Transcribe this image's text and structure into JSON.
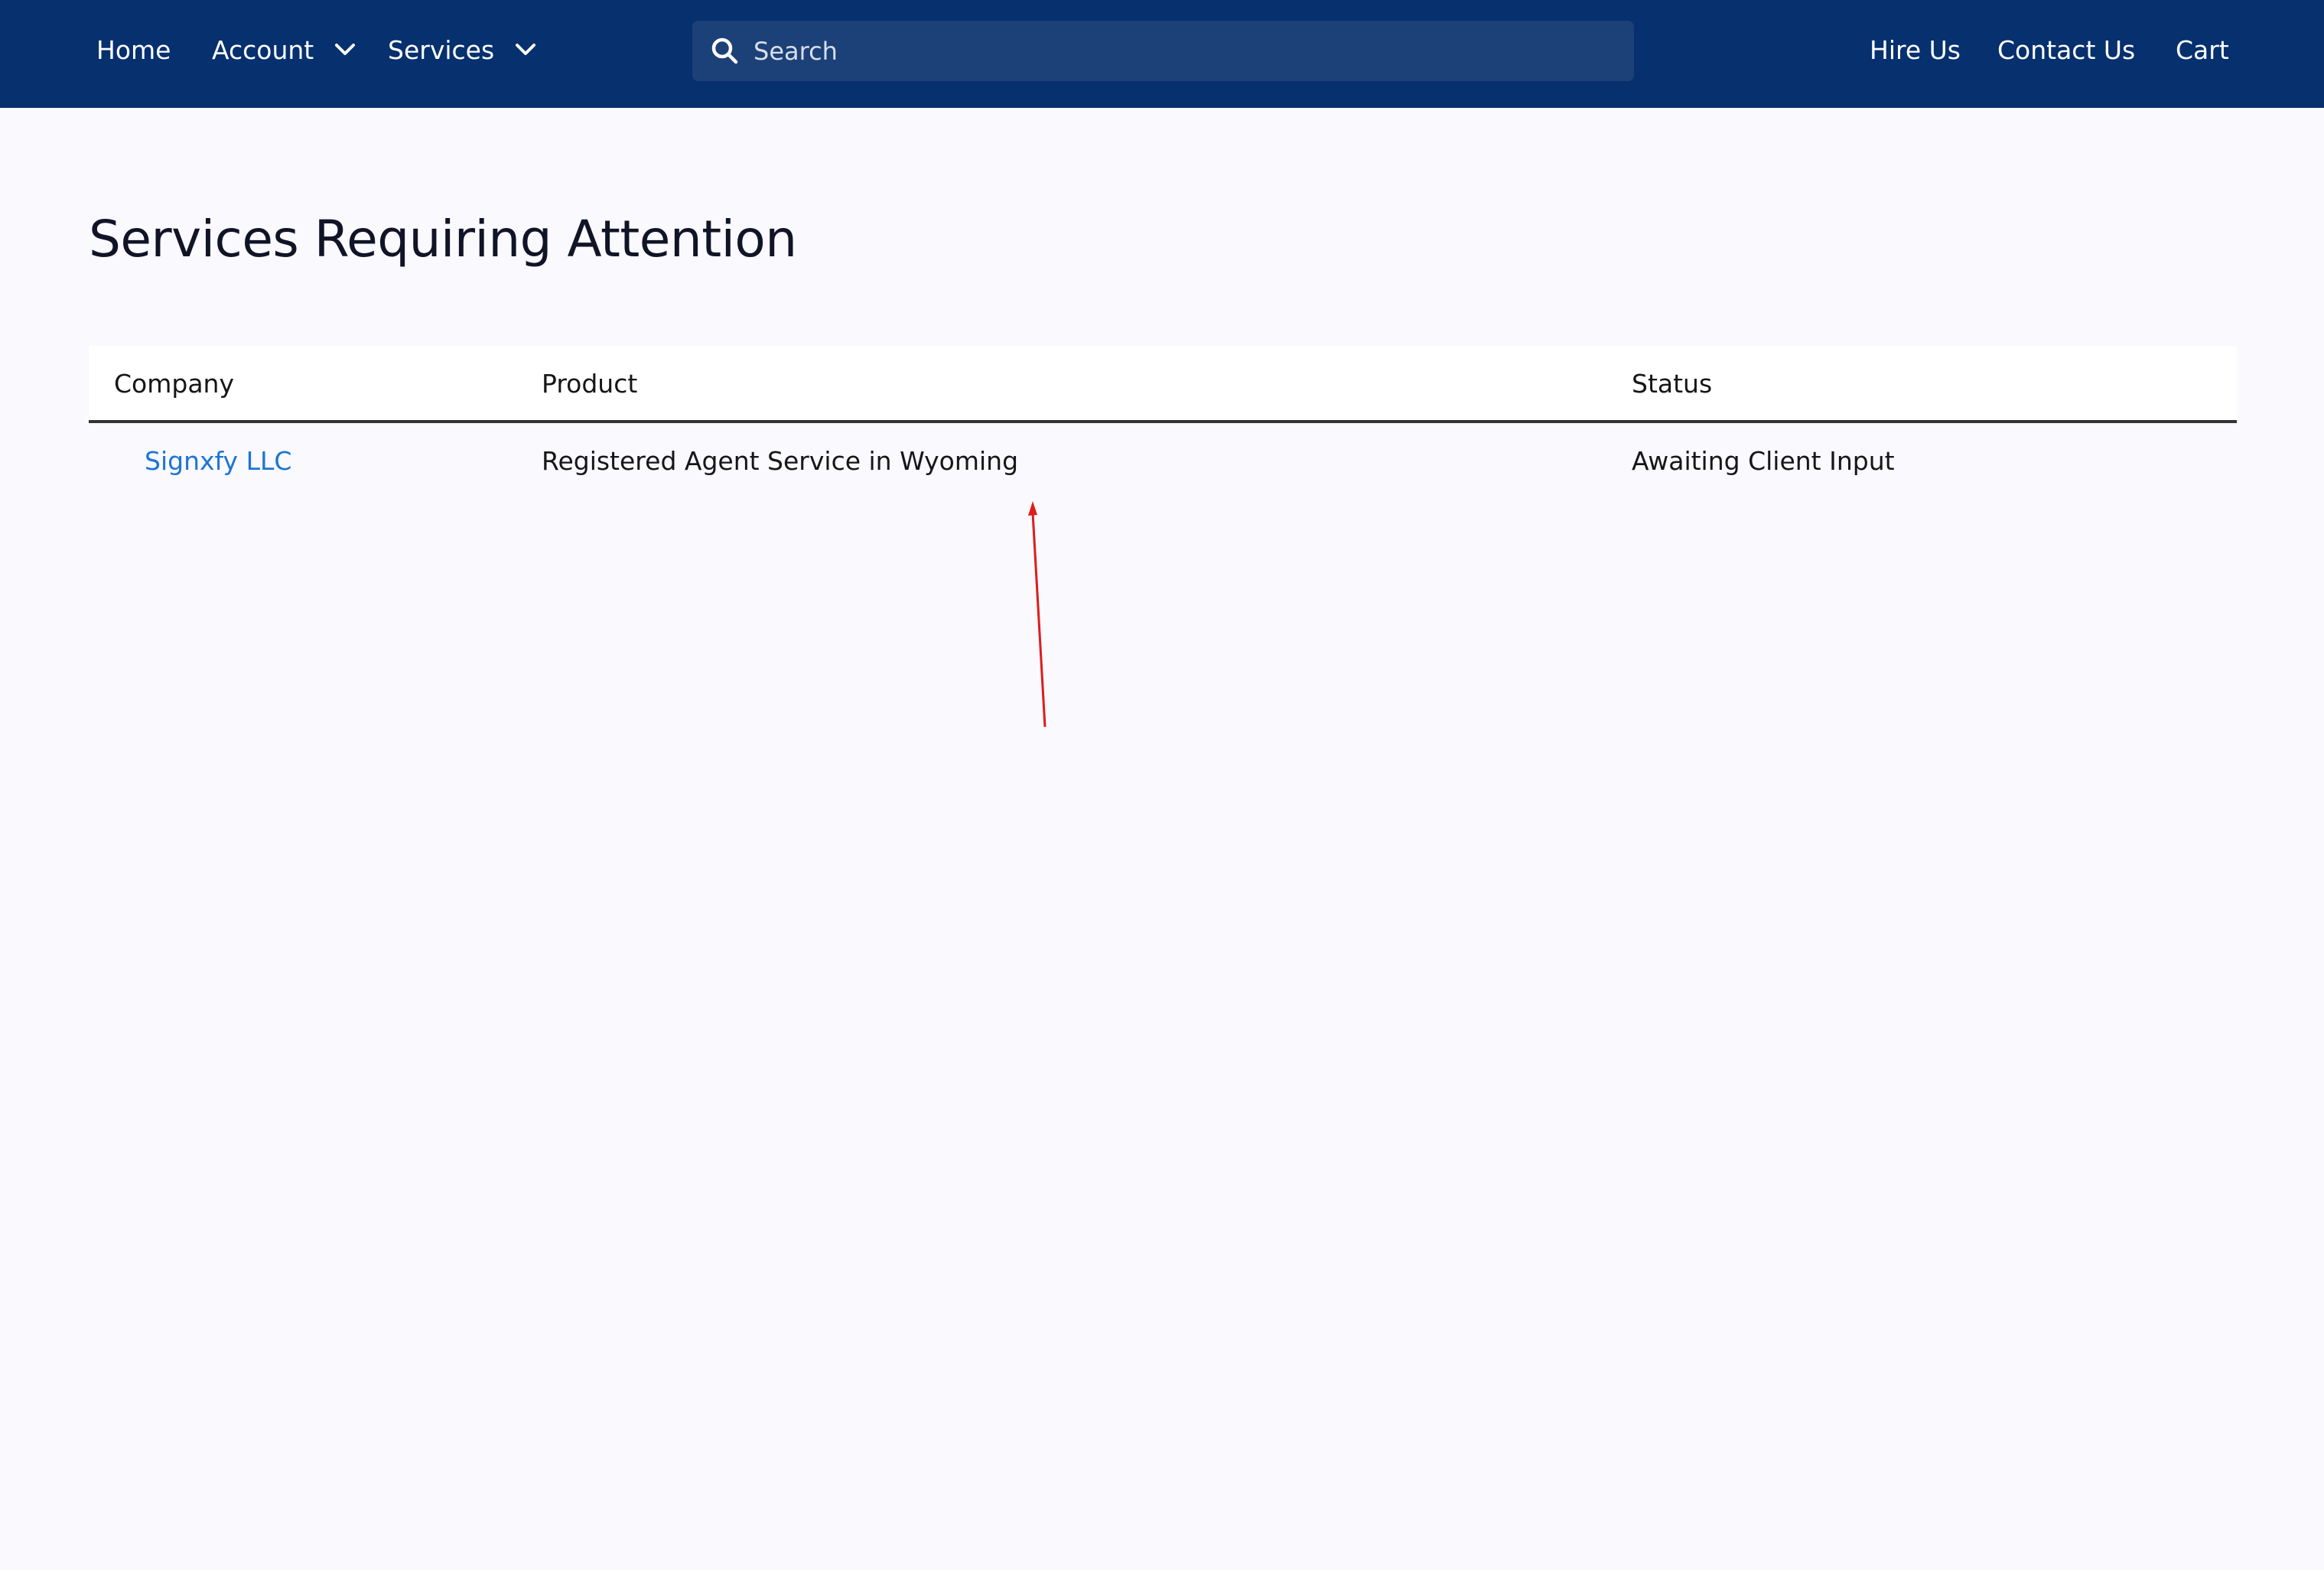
{
  "nav": {
    "home": "Home",
    "account": "Account",
    "services": "Services",
    "hire_us": "Hire Us",
    "contact_us": "Contact Us",
    "cart": "Cart"
  },
  "search": {
    "placeholder": "Search",
    "icon": "search-icon"
  },
  "page": {
    "title": "Services Requiring Attention"
  },
  "table": {
    "headers": [
      "Company",
      "Product",
      "Status"
    ],
    "rows": [
      {
        "company": "Signxfy LLC",
        "product": "Registered Agent Service in Wyoming",
        "status": "Awaiting Client Input"
      }
    ]
  },
  "colors": {
    "header_bg": "#06306e",
    "search_bg": "#1c4178",
    "page_bg": "#f9f9fe",
    "link": "#1c74d6",
    "annotation": "#e11b1b"
  }
}
